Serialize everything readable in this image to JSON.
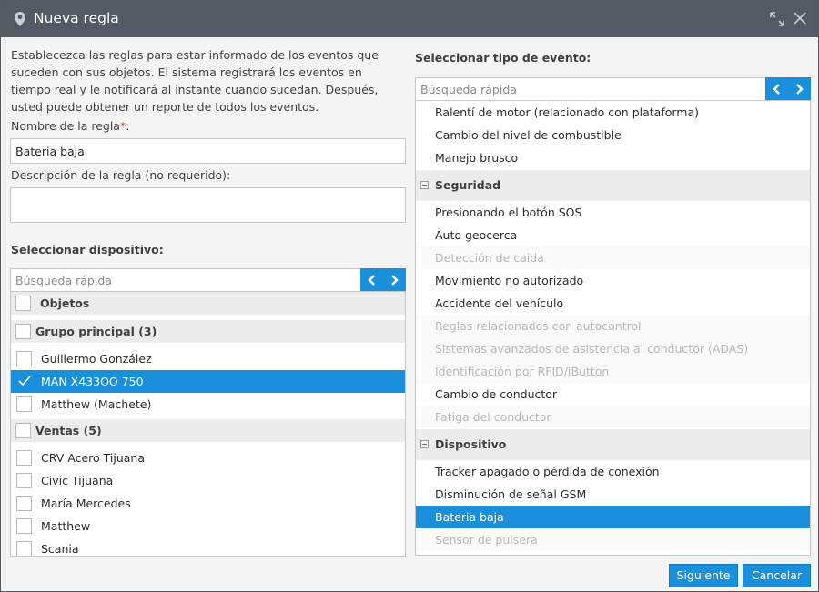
{
  "dialog": {
    "title": "Nueva regla",
    "icons": {
      "pin": "map-pin-icon",
      "maximize": "maximize-icon",
      "close": "close-icon"
    }
  },
  "intro": "Establecezca las reglas para estar informado de los eventos que suceden con sus objetos. El sistema registrará los eventos en tiempo real y le notificará al instante cuando sucedan. Después, usted puede obtener un reporte de todos los eventos.",
  "rule_form": {
    "name_label": "Nombre de la regla",
    "required_mark": "*",
    "name_label_suffix": ":",
    "name_value": "Bateria baja",
    "description_label": "Descripción de la regla (no requerido):",
    "description_value": ""
  },
  "device_selector": {
    "title": "Seleccionar dispositivo:",
    "search_placeholder": "Búsqueda rápida",
    "header_label": "Objetos",
    "groups": [
      {
        "label": "Grupo principal (3)",
        "items": [
          {
            "label": "Guillermo González",
            "checked": false
          },
          {
            "label": "MAN X433OO 750",
            "checked": true
          },
          {
            "label": "Matthew (Machete)",
            "checked": false
          }
        ]
      },
      {
        "label": "Ventas (5)",
        "items": [
          {
            "label": "CRV Acero Tijuana",
            "checked": false
          },
          {
            "label": "Civic Tijuana",
            "checked": false
          },
          {
            "label": "María Mercedes",
            "checked": false
          },
          {
            "label": "Matthew",
            "checked": false
          },
          {
            "label": "Scania",
            "checked": false
          }
        ]
      }
    ]
  },
  "event_selector": {
    "title": "Seleccionar tipo de evento:",
    "search_placeholder": "Búsqueda rápida",
    "rows": [
      {
        "kind": "item",
        "label": "Ralentí de motor (relacionado con plataforma)",
        "state": "normal"
      },
      {
        "kind": "item",
        "label": "Cambio del nivel de combustible",
        "state": "normal"
      },
      {
        "kind": "item",
        "label": "Manejo brusco",
        "state": "normal"
      },
      {
        "kind": "group",
        "label": "Seguridad"
      },
      {
        "kind": "item",
        "label": "Presionando el botón SOS",
        "state": "normal"
      },
      {
        "kind": "item",
        "label": "Auto geocerca",
        "state": "normal"
      },
      {
        "kind": "item",
        "label": "Detección de caida",
        "state": "disabled"
      },
      {
        "kind": "item",
        "label": "Movimiento no autorizado",
        "state": "normal"
      },
      {
        "kind": "item",
        "label": "Accidente del vehículo",
        "state": "normal"
      },
      {
        "kind": "item",
        "label": "Reglas relacionados con autocontrol",
        "state": "disabled"
      },
      {
        "kind": "item",
        "label": "Sistemas avanzados de asistencia al conductor (ADAS)",
        "state": "disabled"
      },
      {
        "kind": "item",
        "label": "Identificación por RFID/iButton",
        "state": "disabled"
      },
      {
        "kind": "item",
        "label": "Cambio de conductor",
        "state": "normal"
      },
      {
        "kind": "item",
        "label": "Fatiga del conductor",
        "state": "disabled"
      },
      {
        "kind": "group",
        "label": "Dispositivo"
      },
      {
        "kind": "item",
        "label": "Tracker apagado o pérdida de conexión",
        "state": "normal"
      },
      {
        "kind": "item",
        "label": "Disminución de señal GSM",
        "state": "normal"
      },
      {
        "kind": "item",
        "label": "Bateria baja",
        "state": "selected"
      },
      {
        "kind": "item",
        "label": "Sensor de pulsera",
        "state": "disabled"
      }
    ]
  },
  "buttons": {
    "next": "Siguiente",
    "cancel": "Cancelar"
  },
  "colors": {
    "titlebar": "#525a63",
    "accent": "#1a8fdb",
    "required": "#d9312b",
    "disabled_text": "#b8b8b8",
    "group_bg": "#ececec"
  }
}
